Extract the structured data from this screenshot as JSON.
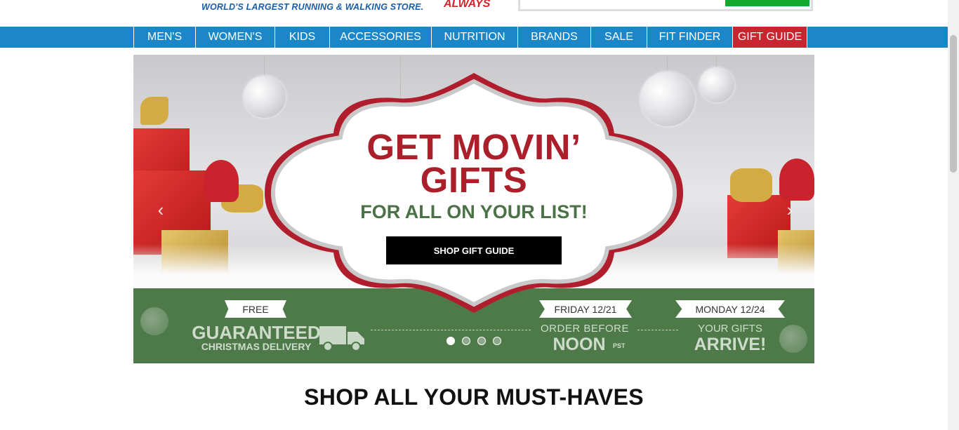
{
  "header": {
    "tagline": "WORLD'S LARGEST RUNNING & WALKING STORE.",
    "always_text": "ALWAYS"
  },
  "nav": {
    "items": [
      {
        "label": "MEN'S"
      },
      {
        "label": "WOMEN'S"
      },
      {
        "label": "KIDS"
      },
      {
        "label": "ACCESSORIES"
      },
      {
        "label": "NUTRITION"
      },
      {
        "label": "BRANDS"
      },
      {
        "label": "SALE"
      },
      {
        "label": "FIT FINDER"
      },
      {
        "label": "GIFT GUIDE"
      }
    ]
  },
  "hero": {
    "title_line1": "GET MOVIN’",
    "title_line2": "GIFTS",
    "subtitle": "FOR ALL ON YOUR LIST!",
    "cta_label": "SHOP GIFT GUIDE",
    "prev_icon": "chevron-left-icon",
    "next_icon": "chevron-right-icon",
    "slide_count": 4,
    "active_slide": 1
  },
  "banner": {
    "free_tag": "FREE",
    "guaranteed": "GUARANTEED",
    "christmas_delivery": "CHRISTMAS DELIVERY",
    "friday_tag": "FRIDAY 12/21",
    "order_before": "ORDER BEFORE",
    "noon": "NOON",
    "pst": "PST",
    "monday_tag": "MONDAY 12/24",
    "your_gifts": "YOUR GIFTS",
    "arrive": "ARRIVE!"
  },
  "section": {
    "title": "SHOP ALL YOUR MUST-HAVES"
  },
  "colors": {
    "nav_blue": "#1b87c9",
    "gift_red": "#c7262e",
    "hero_red": "#ab1f2b",
    "hero_green": "#4b7246",
    "band_green": "#4e7a4a"
  }
}
